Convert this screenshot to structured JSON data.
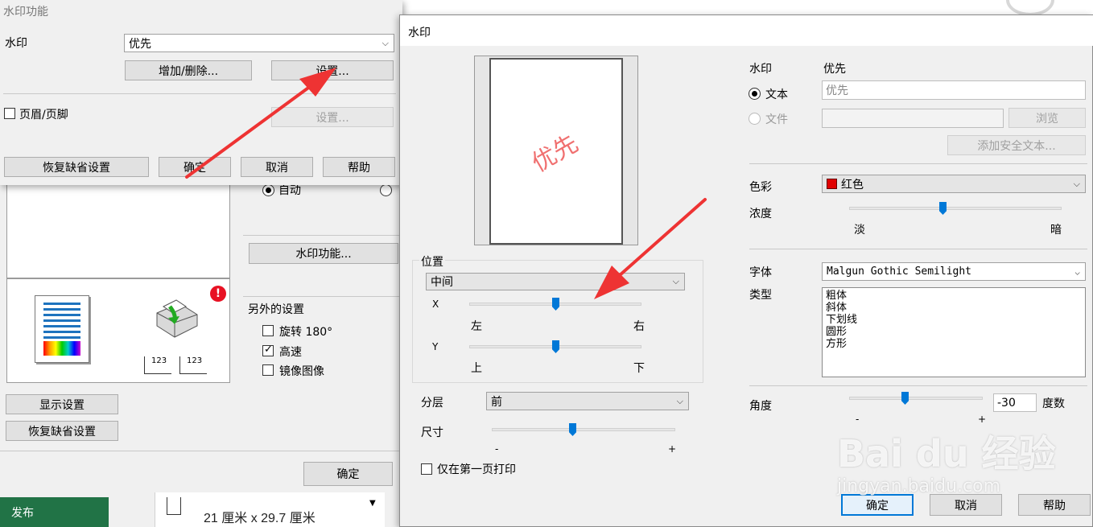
{
  "background": {
    "radio_auto": "自动",
    "watermark_func_button": "水印功能...",
    "other_settings_title": "另外的设置",
    "checks": [
      {
        "label": "旋转 180°",
        "checked": false
      },
      {
        "label": "高速",
        "checked": true
      },
      {
        "label": "镜像图像",
        "checked": false
      }
    ],
    "display_settings": "显示设置",
    "restore_defaults": "恢复缺省设置",
    "ok": "确定",
    "publish": "发布",
    "paper_size": "21 厘米 x 29.7 厘米",
    "error_badge": "!",
    "stack_labels": [
      "123",
      "123"
    ]
  },
  "small_dialog": {
    "title": "水印功能",
    "watermark_label": "水印",
    "watermark_value": "优先",
    "add_delete": "增加/删除...",
    "settings": "设置...",
    "header_footer": "页眉/页脚",
    "settings2": "设置...",
    "restore_defaults": "恢复缺省设置",
    "ok": "确定",
    "cancel": "取消",
    "help": "帮助"
  },
  "main_dialog": {
    "title": "水印",
    "preview_text": "优先",
    "position": {
      "group_label": "位置",
      "select_value": "中间",
      "x_label": "X",
      "x_left": "左",
      "x_right": "右",
      "x_value": 0.5,
      "y_label": "Y",
      "y_top": "上",
      "y_bottom": "下",
      "y_value": 0.5
    },
    "layer_label": "分层",
    "layer_value": "前",
    "size_label": "尺寸",
    "size_minus": "-",
    "size_plus": "+",
    "size_value": 0.45,
    "first_page_only": "仅在第一页打印",
    "watermark_label": "水印",
    "watermark_value": "优先",
    "text_radio": "文本",
    "text_value": "优先",
    "file_radio": "文件",
    "file_value": "",
    "browse": "浏览",
    "add_secure_text": "添加安全文本...",
    "color_label": "色彩",
    "color_value": "红色",
    "color_swatch": "#e00000",
    "density_label": "浓度",
    "density_light": "淡",
    "density_dark": "暗",
    "density_value": 0.45,
    "font_label": "字体",
    "font_value": "Malgun Gothic Semilight",
    "style_label": "类型",
    "styles": [
      "粗体",
      "斜体",
      "下划线",
      "圆形",
      "方形"
    ],
    "angle_label": "角度",
    "angle_value": "-30",
    "angle_unit": "度数",
    "angle_minus": "-",
    "angle_plus": "+",
    "angle_slider": 0.42,
    "ok": "确定",
    "cancel": "取消",
    "help": "帮助"
  },
  "overlay": {
    "watermark_logo": "Bai du 经验",
    "watermark_url": "jingyan.baidu.com"
  }
}
